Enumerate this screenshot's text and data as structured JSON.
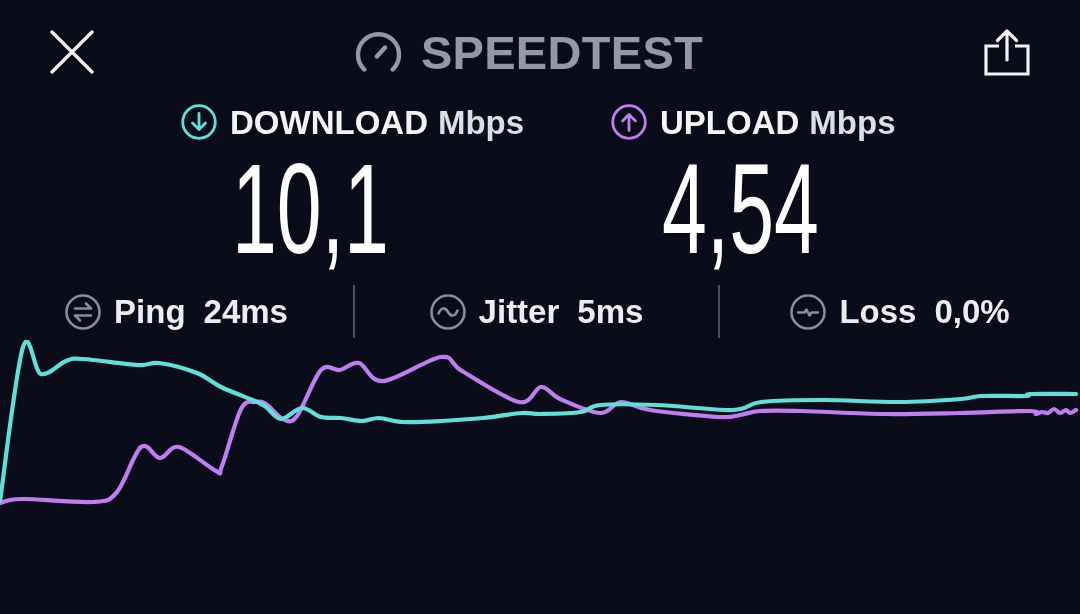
{
  "header": {
    "title": "SPEEDTEST"
  },
  "results": [
    {
      "kind": "download",
      "label": "DOWNLOAD",
      "unit": "Mbps",
      "value": "10,1",
      "color": "#5fe0d6"
    },
    {
      "kind": "upload",
      "label": "UPLOAD",
      "unit": "Mbps",
      "value": "4,54",
      "color": "#bf7df0"
    }
  ],
  "stats": [
    {
      "kind": "ping",
      "label": "Ping",
      "value": "24ms"
    },
    {
      "kind": "jitter",
      "label": "Jitter",
      "value": "5ms"
    },
    {
      "kind": "loss",
      "label": "Loss",
      "value": "0,0%"
    }
  ]
}
